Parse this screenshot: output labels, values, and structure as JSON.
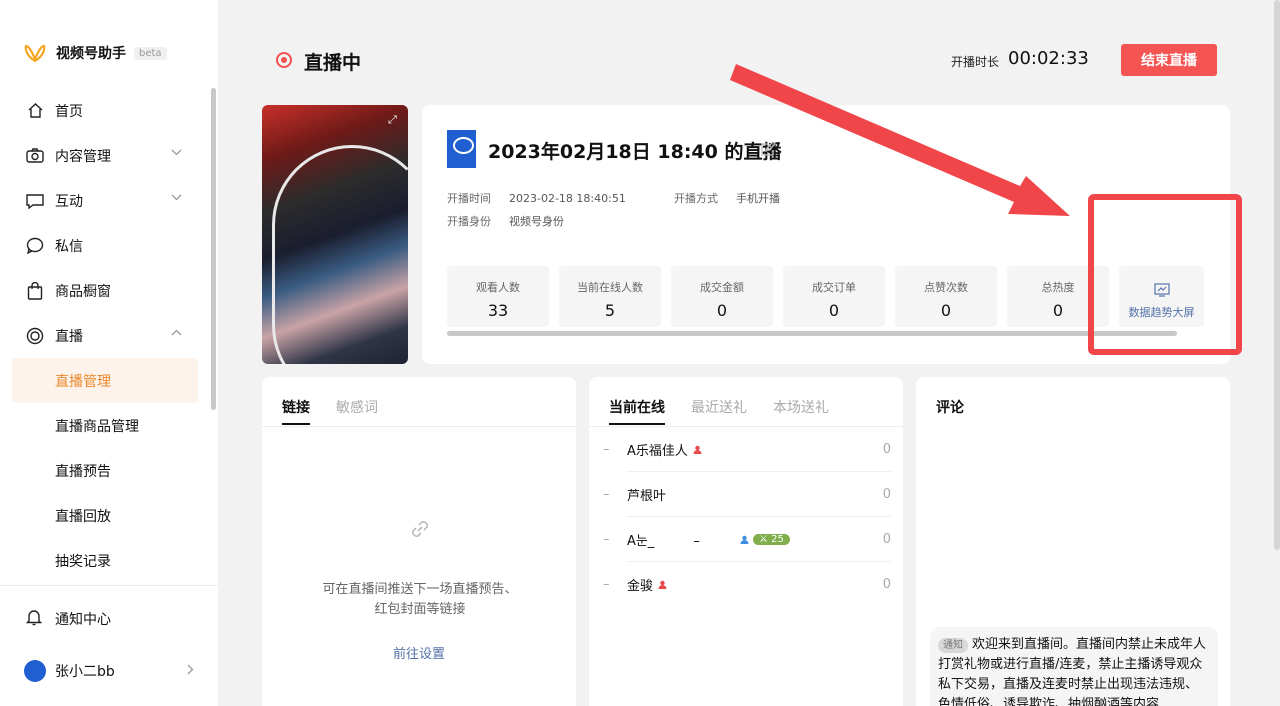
{
  "brand": {
    "name": "视频号助手",
    "badge": "beta"
  },
  "nav": {
    "items": [
      {
        "label": "首页",
        "icon": "home-icon"
      },
      {
        "label": "内容管理",
        "icon": "camera-icon"
      },
      {
        "label": "互动",
        "icon": "message-icon"
      },
      {
        "label": "私信",
        "icon": "chat-bubble-icon"
      },
      {
        "label": "商品橱窗",
        "icon": "shopping-bag-icon"
      },
      {
        "label": "直播",
        "icon": "live-icon"
      }
    ],
    "live_sub": [
      {
        "label": "直播管理",
        "active": true
      },
      {
        "label": "直播商品管理"
      },
      {
        "label": "直播预告"
      },
      {
        "label": "直播回放"
      },
      {
        "label": "抽奖记录"
      }
    ],
    "notice": "通知中心",
    "user": "张小二bb"
  },
  "header": {
    "status": "直播中",
    "duration_label": "开播时长",
    "duration": "00:02:33",
    "end_button": "结束直播"
  },
  "info": {
    "title": "2023年02月18日 18:40 的直播",
    "start_time_label": "开播时间",
    "start_time": "2023-02-18 18:40:51",
    "method_label": "开播方式",
    "method": "手机开播",
    "identity_label": "开播身份",
    "identity": "视频号身份",
    "stats": [
      {
        "label": "观看人数",
        "value": "33"
      },
      {
        "label": "当前在线人数",
        "value": "5"
      },
      {
        "label": "成交金额",
        "value": "0"
      },
      {
        "label": "成交订单",
        "value": "0"
      },
      {
        "label": "点赞次数",
        "value": "0"
      },
      {
        "label": "总热度",
        "value": "0"
      }
    ],
    "trend_label": "数据趋势大屏"
  },
  "links_card": {
    "tabs": [
      "链接",
      "敏感词"
    ],
    "empty_text": "可在直播间推送下一场直播预告、红包封面等链接",
    "action": "前往设置"
  },
  "online_card": {
    "tabs": [
      "当前在线",
      "最近送礼",
      "本场送礼"
    ],
    "rows": [
      {
        "dash": "–",
        "name": "A乐福佳人",
        "count": "0"
      },
      {
        "dash": "–",
        "name": "芦根叶",
        "count": "0"
      },
      {
        "dash": "–",
        "name": "A눈_　　　–",
        "count": "0",
        "level": "25"
      },
      {
        "dash": "–",
        "name": "金骏",
        "count": "0"
      }
    ]
  },
  "comments_card": {
    "title": "评论",
    "notice_tag": "通知",
    "notice_text": "欢迎来到直播间。直播间内禁止未成年人打赏礼物或进行直播/连麦，禁止主播诱导观众私下交易，直播及连麦时禁止出现违法违规、色情低俗、诱导欺诈、抽烟酗酒等内容"
  },
  "colors": {
    "accent": "#e9892e",
    "danger": "#f45452",
    "link": "#5372a8",
    "annotation": "#f0464a"
  }
}
